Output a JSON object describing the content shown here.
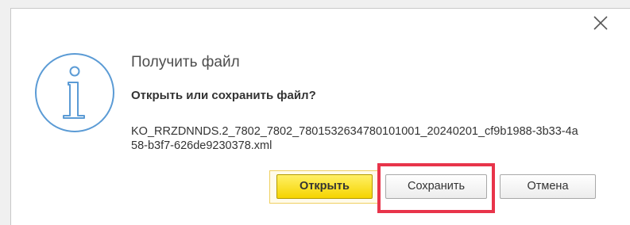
{
  "dialog": {
    "title": "Получить файл",
    "question": "Открыть или сохранить файл?",
    "filename": "KO_RRZDNNDS.2_7802_7802_7801532634780101001_20240201_cf9b1988-3b33-4a58-b3f7-626de9230378.xml"
  },
  "buttons": {
    "open_label": "Открыть",
    "save_label": "Сохранить",
    "cancel_label": "Отмена"
  },
  "icons": {
    "info": "info-icon",
    "close": "close-icon"
  },
  "colors": {
    "info_icon": "#5b9bd5",
    "primary_button": "#f5d400",
    "highlight": "#e8344a"
  }
}
